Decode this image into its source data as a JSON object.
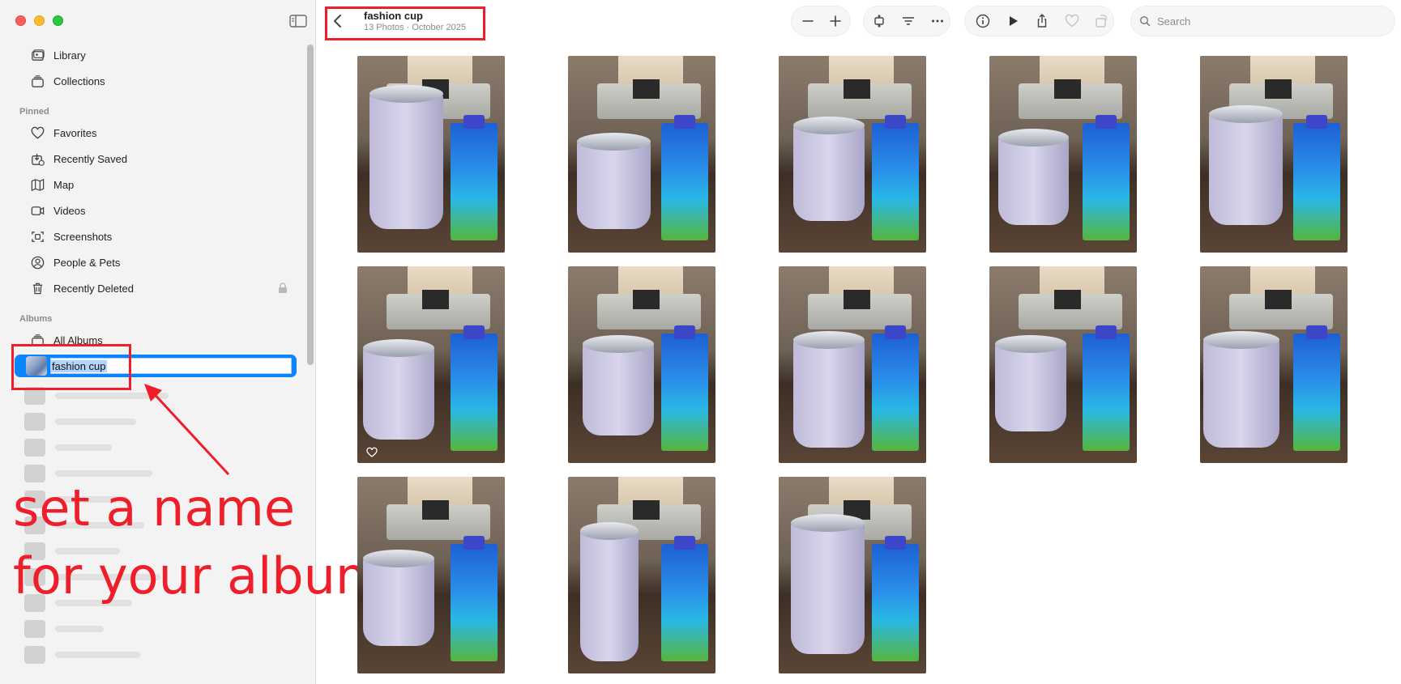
{
  "sidebar": {
    "items_top": [
      {
        "label": "Library",
        "icon": "photo-library-icon"
      },
      {
        "label": "Collections",
        "icon": "collections-icon"
      }
    ],
    "pinned_label": "Pinned",
    "pinned": [
      {
        "label": "Favorites",
        "icon": "heart-icon"
      },
      {
        "label": "Recently Saved",
        "icon": "recently-saved-icon"
      },
      {
        "label": "Map",
        "icon": "map-icon"
      },
      {
        "label": "Videos",
        "icon": "video-icon"
      },
      {
        "label": "Screenshots",
        "icon": "screenshot-icon"
      },
      {
        "label": "People & Pets",
        "icon": "person-icon"
      },
      {
        "label": "Recently Deleted",
        "icon": "trash-icon"
      }
    ],
    "albums_label": "Albums",
    "all_albums": "All Albums",
    "album_rename_value": "fashion cup"
  },
  "annotation": {
    "text_line1": "set a name",
    "text_line2": "for your album"
  },
  "header": {
    "title": "fashion cup",
    "subtitle": "13 Photos · October 2025"
  },
  "search": {
    "placeholder": "Search"
  },
  "grid": {
    "photo_count": 13,
    "favorited_photo_index": 5
  },
  "colors": {
    "accent": "#0a84ff",
    "annotation": "#ee1f2b"
  }
}
